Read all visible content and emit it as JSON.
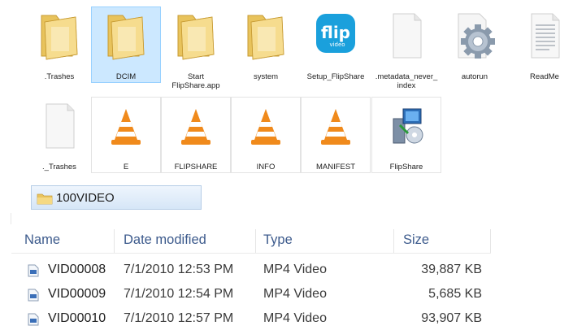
{
  "icons": [
    {
      "label": ".Trashes",
      "type": "folder",
      "selected": false
    },
    {
      "label": "DCIM",
      "type": "folder",
      "selected": true
    },
    {
      "label": "Start\nFlipShare.app",
      "type": "folder",
      "selected": false
    },
    {
      "label": "system",
      "type": "folder",
      "selected": false
    },
    {
      "label": "Setup_FlipShare",
      "type": "flip",
      "selected": false
    },
    {
      "label": ".metadata_never_\nindex",
      "type": "doc",
      "selected": false
    },
    {
      "label": "autorun",
      "type": "gear",
      "selected": false
    },
    {
      "label": "ReadMe",
      "type": "lines",
      "selected": false
    },
    {
      "label": "._Trashes",
      "type": "doc",
      "selected": false
    },
    {
      "label": "E",
      "type": "vlc",
      "selected": false
    },
    {
      "label": "FLIPSHARE",
      "type": "vlc",
      "selected": false
    },
    {
      "label": "INFO",
      "type": "vlc",
      "selected": false
    },
    {
      "label": "MANIFEST",
      "type": "vlc",
      "selected": false
    },
    {
      "label": "FlipShare",
      "type": "installer",
      "selected": false
    }
  ],
  "flip_logo_text": "flip",
  "flip_logo_subtext": "video",
  "address": {
    "folder": "100VIDEO"
  },
  "columns": {
    "name": "Name",
    "date": "Date modified",
    "type": "Type",
    "size": "Size"
  },
  "files": [
    {
      "name": "VID00008",
      "date": "7/1/2010 12:53 PM",
      "type": "MP4 Video",
      "size": "39,887 KB"
    },
    {
      "name": "VID00009",
      "date": "7/1/2010 12:54 PM",
      "type": "MP4 Video",
      "size": "5,685 KB"
    },
    {
      "name": "VID00010",
      "date": "7/1/2010 12:57 PM",
      "type": "MP4 Video",
      "size": "93,907 KB"
    }
  ],
  "colors": {
    "selection": "#cce8ff",
    "folder": "#f2d27a",
    "flip_blue": "#1aa0dc",
    "vlc_orange": "#f08a1c",
    "header_text": "#3c5a8c"
  }
}
